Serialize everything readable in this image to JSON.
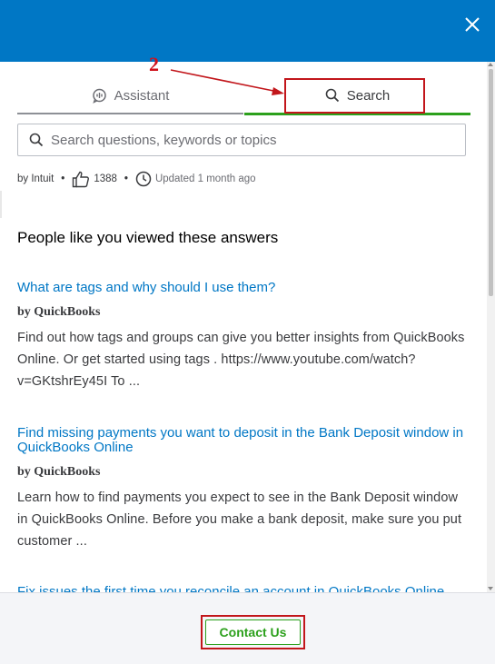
{
  "header": {
    "close_icon": "close-icon"
  },
  "annotation": {
    "step_number": "2",
    "color": "#d0121b"
  },
  "tabs": [
    {
      "label": "Assistant",
      "icon": "chat-bubble-icon"
    },
    {
      "label": "Search",
      "icon": "search-icon",
      "active": true
    }
  ],
  "search": {
    "placeholder": "Search questions, keywords or topics"
  },
  "meta": {
    "author": "by Intuit",
    "likes": "1388",
    "updated": "Updated 1 month ago"
  },
  "section_title": "People like you viewed these answers",
  "articles": [
    {
      "title": "What are tags and why should I use them?",
      "by": "by QuickBooks",
      "snippet": "Find out how tags and groups can give you better insights from QuickBooks Online. Or get started using tags . https://www.youtube.com/watch?v=GKtshrEy45I To ..."
    },
    {
      "title": "Find missing payments you want to deposit in the Bank Deposit window in QuickBooks Online",
      "by": "by QuickBooks",
      "snippet": "Learn how to find payments you expect to see in the Bank Deposit window in QuickBooks Online. Before you make a bank deposit, make sure you put customer ..."
    },
    {
      "title": "Fix issues the first time you reconcile an account in QuickBooks Online"
    }
  ],
  "footer": {
    "contact_label": "Contact Us"
  },
  "colors": {
    "header": "#0077c5",
    "link": "#0077c5",
    "accent_green": "#2ca01c",
    "annotation_red": "#c2161b"
  }
}
